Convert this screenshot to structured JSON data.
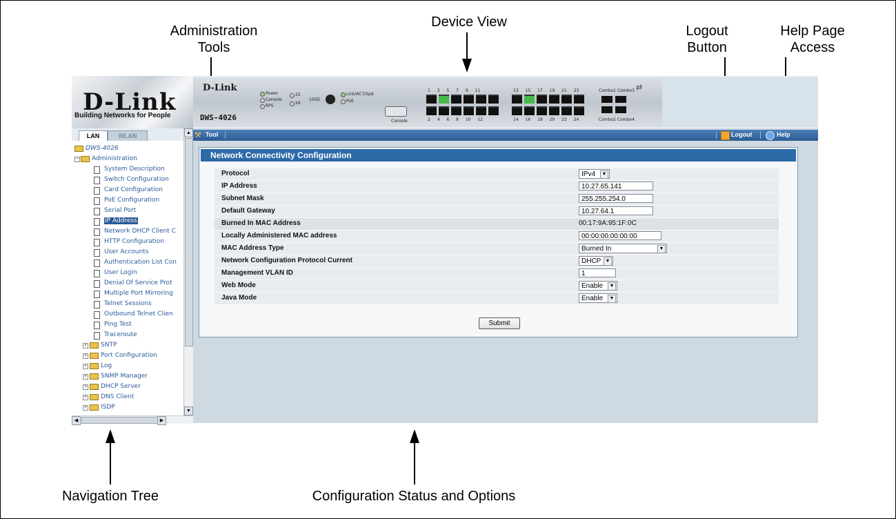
{
  "callouts": {
    "admin_tools": "Administration\nTools",
    "device_view": "Device View",
    "logout_button": "Logout\nButton",
    "help_access": "Help Page\nAccess",
    "nav_tree": "Navigation Tree",
    "config_status": "Configuration Status and Options"
  },
  "header": {
    "logo": "D-Link",
    "logo_tagline": "Building Networks for People",
    "device_brand": "D-Link",
    "device_model": "DWS-4026",
    "led_labels": [
      "Power",
      "Console",
      "RPS",
      "25",
      "26",
      "10GE",
      "Link/ACT/Spd",
      "PoE",
      "Console"
    ],
    "port_numbers_top": "1 3 5 7 9 11",
    "port_numbers_bottom": "2 4 6 8 10 12",
    "port_numbers_top2": "13 15 17 19 21 23",
    "port_numbers_bottom2": "14 16 18 20 22 24",
    "combo_top": "Combo1 Combo3",
    "combo_bottom": "Combo2 Combo4"
  },
  "toolbar": {
    "tool_label": "Tool",
    "logout_label": "Logout",
    "help_label": "Help"
  },
  "tabs": {
    "lan": "LAN",
    "wlan": "WLAN"
  },
  "nav": {
    "root": "DWS-4026",
    "admin": "Administration",
    "admin_items": [
      "System Description",
      "Switch Configuration",
      "Card Configuration",
      "PoE Configuration",
      "Serial Port",
      "IP Address",
      "Network DHCP Client C",
      "HTTP Configuration",
      "User Accounts",
      "Authentication List Con",
      "User Login",
      "Denial Of Service Prot",
      "Multiple Port Mirroring",
      "Telnet Sessions",
      "Outbound Telnet Clien",
      "Ping Test",
      "Traceroute"
    ],
    "folders": [
      "SNTP",
      "Port Configuration",
      "Log",
      "SNMP Manager",
      "DHCP Server",
      "DNS Client",
      "ISDP"
    ],
    "selected": "IP Address"
  },
  "panel": {
    "title": "Network Connectivity Configuration",
    "rows": [
      {
        "label": "Protocol",
        "kind": "select",
        "value": "IPv4"
      },
      {
        "label": "IP Address",
        "kind": "input",
        "value": "10.27.65.141"
      },
      {
        "label": "Subnet Mask",
        "kind": "input",
        "value": "255.255.254.0"
      },
      {
        "label": "Default Gateway",
        "kind": "input",
        "value": "10.27.64.1"
      },
      {
        "label": "Burned In MAC Address",
        "kind": "text",
        "value": "00:17:9A:95:1F:0C"
      },
      {
        "label": "Locally Administered MAC address",
        "kind": "input",
        "value": "00:00:00:00:00:00"
      },
      {
        "label": "MAC Address Type",
        "kind": "select",
        "value": "Burned In"
      },
      {
        "label": "Network Configuration Protocol Current",
        "kind": "select",
        "value": "DHCP"
      },
      {
        "label": "Management VLAN ID",
        "kind": "input",
        "value": "1"
      },
      {
        "label": "Web Mode",
        "kind": "select",
        "value": "Enable"
      },
      {
        "label": "Java Mode",
        "kind": "select",
        "value": "Enable"
      }
    ],
    "submit": "Submit"
  },
  "colors": {
    "toolbar": "#2b5b92",
    "panel_title": "#2d6aa8",
    "screen_bg": "#ced9e2",
    "nav_link": "#2a5a9a"
  }
}
